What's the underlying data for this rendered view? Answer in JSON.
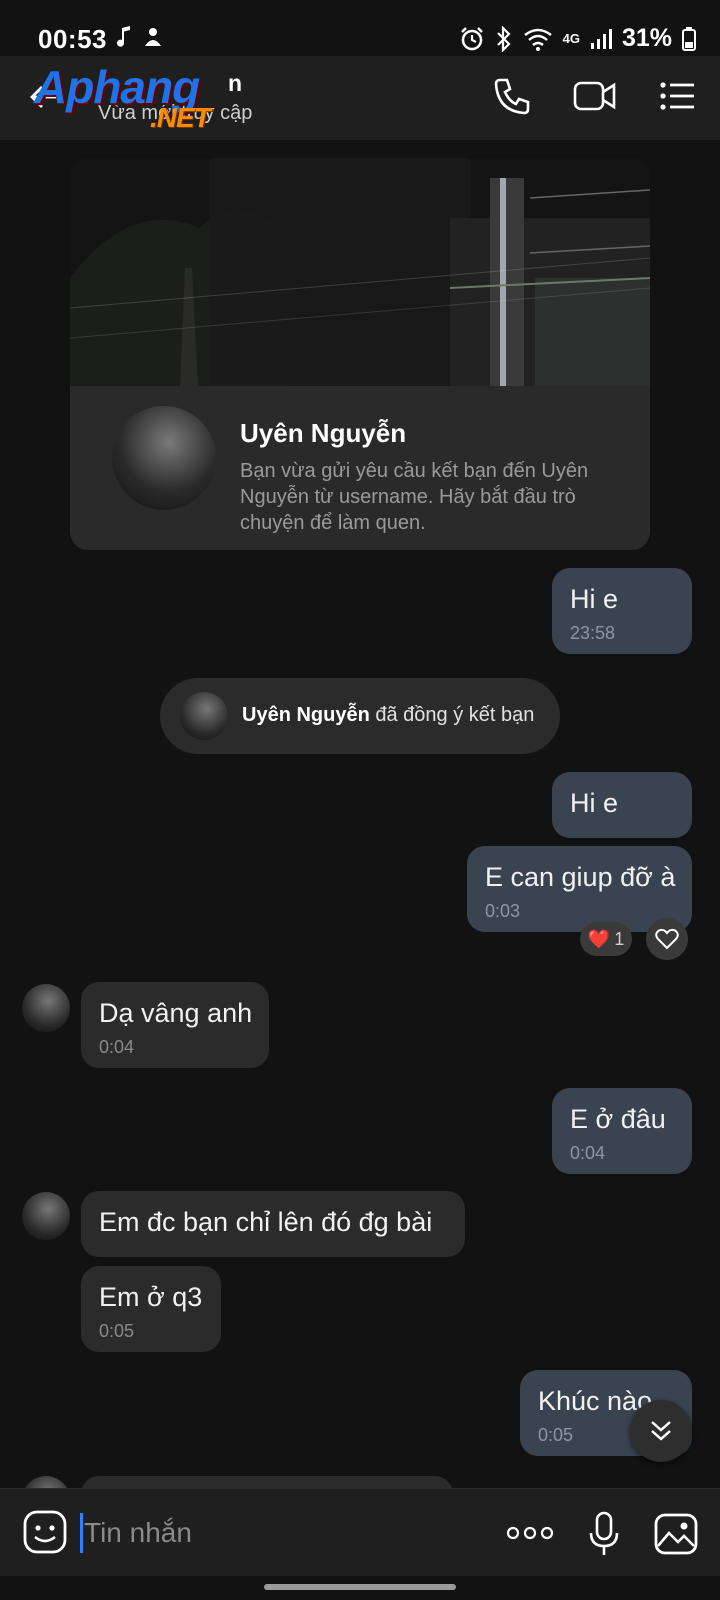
{
  "status_bar": {
    "time": "00:53",
    "network": "4G",
    "battery": "31%"
  },
  "header": {
    "contact_name": "Uyên Nguyễn",
    "contact_name_visible": "n",
    "status": "Vừa mới truy cập",
    "watermark": "Aphang",
    "watermark_suffix": ".NET"
  },
  "profile_card": {
    "name": "Uyên Nguyễn",
    "description": "Bạn vừa gửi yêu cầu kết bạn đến Uyên Nguyễn từ username. Hãy bắt đầu trò chuyện để làm quen."
  },
  "system_message": {
    "name": "Uyên Nguyễn",
    "text": "đã đồng ý kết bạn"
  },
  "messages": [
    {
      "direction": "out",
      "text": "Hi e",
      "time": "23:58"
    },
    {
      "direction": "out",
      "text": "Hi e",
      "time": ""
    },
    {
      "direction": "out",
      "text": "E can giup đỡ à",
      "time": "0:03"
    },
    {
      "direction": "in",
      "text": "Dạ vâng anh",
      "time": "0:04"
    },
    {
      "direction": "out",
      "text": "E ở đâu",
      "time": "0:04"
    },
    {
      "direction": "in",
      "text": "Em đc bạn chỉ lên đó đg bài",
      "time": ""
    },
    {
      "direction": "in",
      "text": "Em ở q3",
      "time": "0:05"
    },
    {
      "direction": "out",
      "text": "Khúc nào",
      "time": "0:05"
    }
  ],
  "reaction": {
    "emoji": "❤️",
    "count": "1"
  },
  "input": {
    "placeholder": "Tin nhắn"
  },
  "colors": {
    "background": "#121212",
    "outgoing_bubble": "#3a4451",
    "incoming_bubble": "#2b2b2b",
    "cursor": "#2f80ff"
  }
}
